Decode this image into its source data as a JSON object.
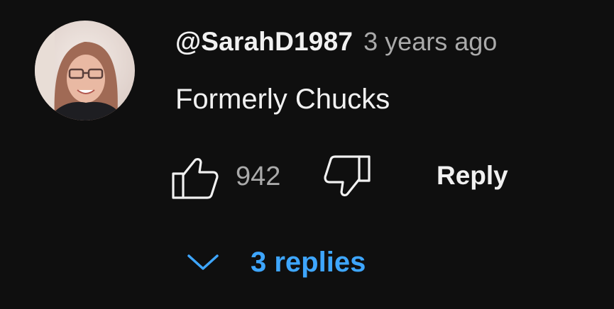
{
  "comment": {
    "author": "@SarahD1987",
    "timestamp": "3 years ago",
    "text": "Formerly Chucks",
    "like_count": "942",
    "reply_label": "Reply",
    "replies_label": "3 replies",
    "icons": {
      "like": "thumbs-up-icon",
      "dislike": "thumbs-down-icon",
      "expand": "chevron-down-icon"
    },
    "colors": {
      "background": "#0f0f0f",
      "primary_text": "#f1f1f1",
      "secondary_text": "#aaaaaa",
      "link": "#3ea6ff"
    }
  }
}
